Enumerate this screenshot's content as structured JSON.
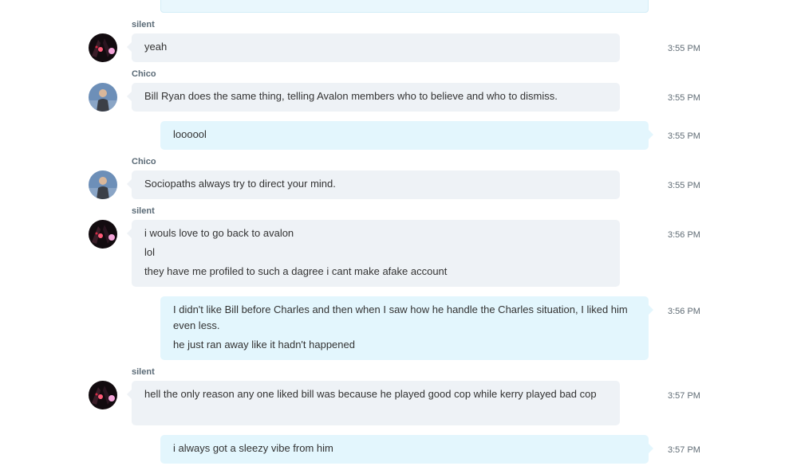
{
  "messages": [
    {
      "sender": "silent",
      "avatar": "silent",
      "direction": "in",
      "lines": [
        "yeah"
      ],
      "time": "3:55 PM"
    },
    {
      "sender": "Chico",
      "avatar": "chico",
      "direction": "in",
      "lines": [
        "Bill Ryan does the same thing, telling Avalon members who to believe and who to dismiss."
      ],
      "time": "3:55 PM"
    },
    {
      "sender": "",
      "avatar": "",
      "direction": "out",
      "lines": [
        "loooool"
      ],
      "time": "3:55 PM"
    },
    {
      "sender": "Chico",
      "avatar": "chico",
      "direction": "in",
      "lines": [
        "Sociopaths always try to direct your mind."
      ],
      "time": "3:55 PM"
    },
    {
      "sender": "silent",
      "avatar": "silent",
      "direction": "in",
      "lines": [
        "i wouls love to go back to avalon",
        "lol",
        "they have me profiled to such a dagree  i cant make afake account"
      ],
      "time": "3:56 PM"
    },
    {
      "sender": "",
      "avatar": "",
      "direction": "out",
      "lines": [
        "I didn't like Bill before Charles and then when I saw how he handle the Charles situation, I liked him even less.",
        "he just ran away like it hadn't happened"
      ],
      "time": "3:56 PM"
    },
    {
      "sender": "silent",
      "avatar": "silent",
      "direction": "in",
      "lines": [
        "hell the only reason any one liked bill was because he played good cop while kerry played bad cop"
      ],
      "time": "3:57 PM"
    },
    {
      "sender": "",
      "avatar": "",
      "direction": "out",
      "lines": [
        "i always got a sleezy vibe from him"
      ],
      "time": "3:57 PM"
    }
  ]
}
